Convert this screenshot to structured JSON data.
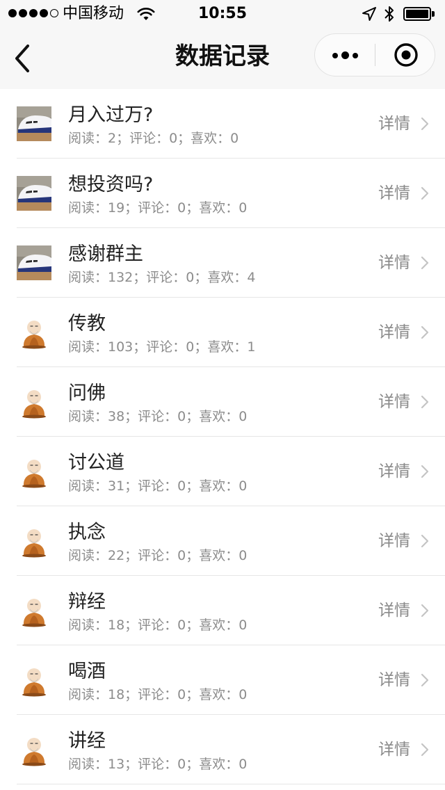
{
  "status_bar": {
    "carrier": "中国移动",
    "time": "10:55",
    "battery_level": 1.0
  },
  "nav": {
    "title": "数据记录",
    "icons": {
      "back": "chevron-left-icon",
      "more": "more-dots-icon",
      "close": "target-circle-icon"
    }
  },
  "list": {
    "detail_label": "详情",
    "items": [
      {
        "title": "月入过万?",
        "stats": "阅读：2；评论：0；喜欢：0",
        "thumbnail": "airplane"
      },
      {
        "title": "想投资吗?",
        "stats": "阅读：19；评论：0；喜欢：0",
        "thumbnail": "airplane"
      },
      {
        "title": "感谢群主",
        "stats": "阅读：132；评论：0；喜欢：4",
        "thumbnail": "airplane"
      },
      {
        "title": "传教",
        "stats": "阅读：103；评论：0；喜欢：1",
        "thumbnail": "monk"
      },
      {
        "title": "问佛",
        "stats": "阅读：38；评论：0；喜欢：0",
        "thumbnail": "monk"
      },
      {
        "title": "讨公道",
        "stats": "阅读：31；评论：0；喜欢：0",
        "thumbnail": "monk"
      },
      {
        "title": "执念",
        "stats": "阅读：22；评论：0；喜欢：0",
        "thumbnail": "monk"
      },
      {
        "title": "辩经",
        "stats": "阅读：18；评论：0；喜欢：0",
        "thumbnail": "monk"
      },
      {
        "title": "喝酒",
        "stats": "阅读：18；评论：0；喜欢：0",
        "thumbnail": "monk"
      },
      {
        "title": "讲经",
        "stats": "阅读：13；评论：0；喜欢：0",
        "thumbnail": "monk"
      }
    ]
  },
  "colors": {
    "header_bg": "#f7f7f7",
    "stats_text": "#8c8c8c",
    "detail_text": "#8a8a8a",
    "divider": "#e6e6e6"
  }
}
